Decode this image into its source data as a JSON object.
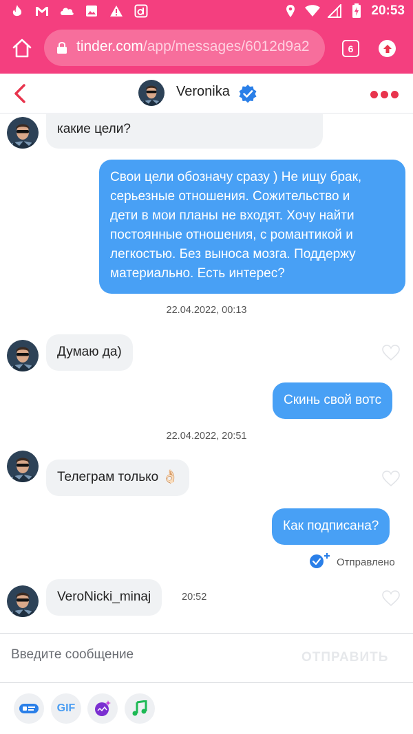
{
  "statusbar": {
    "time": "20:53",
    "left_icons": [
      "tinder-flame-icon",
      "gmail-icon",
      "cloud-icon",
      "image-icon",
      "warning-icon",
      "app-d-icon"
    ],
    "right_icons": [
      "location-icon",
      "wifi-icon",
      "signal-icon",
      "battery-icon"
    ]
  },
  "browser": {
    "url_host": "tinder.com",
    "url_path": "/app/messages/6012d9a2",
    "tab_count": "6"
  },
  "chat": {
    "contact_name": "Veronika",
    "verified": true
  },
  "messages": [
    {
      "type": "in",
      "text": "какие цели?"
    },
    {
      "type": "out",
      "lines": [
        "Свои цели обозначу сразу ) Не ищу брак,",
        "серьезные отношения. Сожительство и",
        "дети в мои планы не входят. Хочу найти",
        "постоянные отношения, с романтикой и",
        "легкостью. Без выноса мозга. Поддержу",
        "материально. Есть интерес?"
      ]
    },
    {
      "type": "timestamp",
      "text": "22.04.2022, 00:13"
    },
    {
      "type": "in",
      "text": "Думаю да)"
    },
    {
      "type": "out",
      "text": "Скинь свой вотс"
    },
    {
      "type": "timestamp",
      "text": "22.04.2022, 20:51"
    },
    {
      "type": "in",
      "text": "Телеграм только 👌🏻"
    },
    {
      "type": "out",
      "text": "Как подписана?"
    },
    {
      "type": "status",
      "text": "Отправлено"
    },
    {
      "type": "in",
      "text": "VeroNicki_minaj",
      "time": "20:52"
    }
  ],
  "composer": {
    "placeholder": "Введите сообщение",
    "send_label": "ОТПРАВИТЬ"
  },
  "tools": {
    "gif_label": "GIF",
    "icons": [
      "sticker-card-icon",
      "gif-icon",
      "swipe-night-icon",
      "music-icon"
    ]
  },
  "colors": {
    "brand_pink": "#f43f7f",
    "bubble_out": "#48a0f5",
    "bubble_in": "#f0f2f4",
    "accent_red": "#e8344d"
  }
}
